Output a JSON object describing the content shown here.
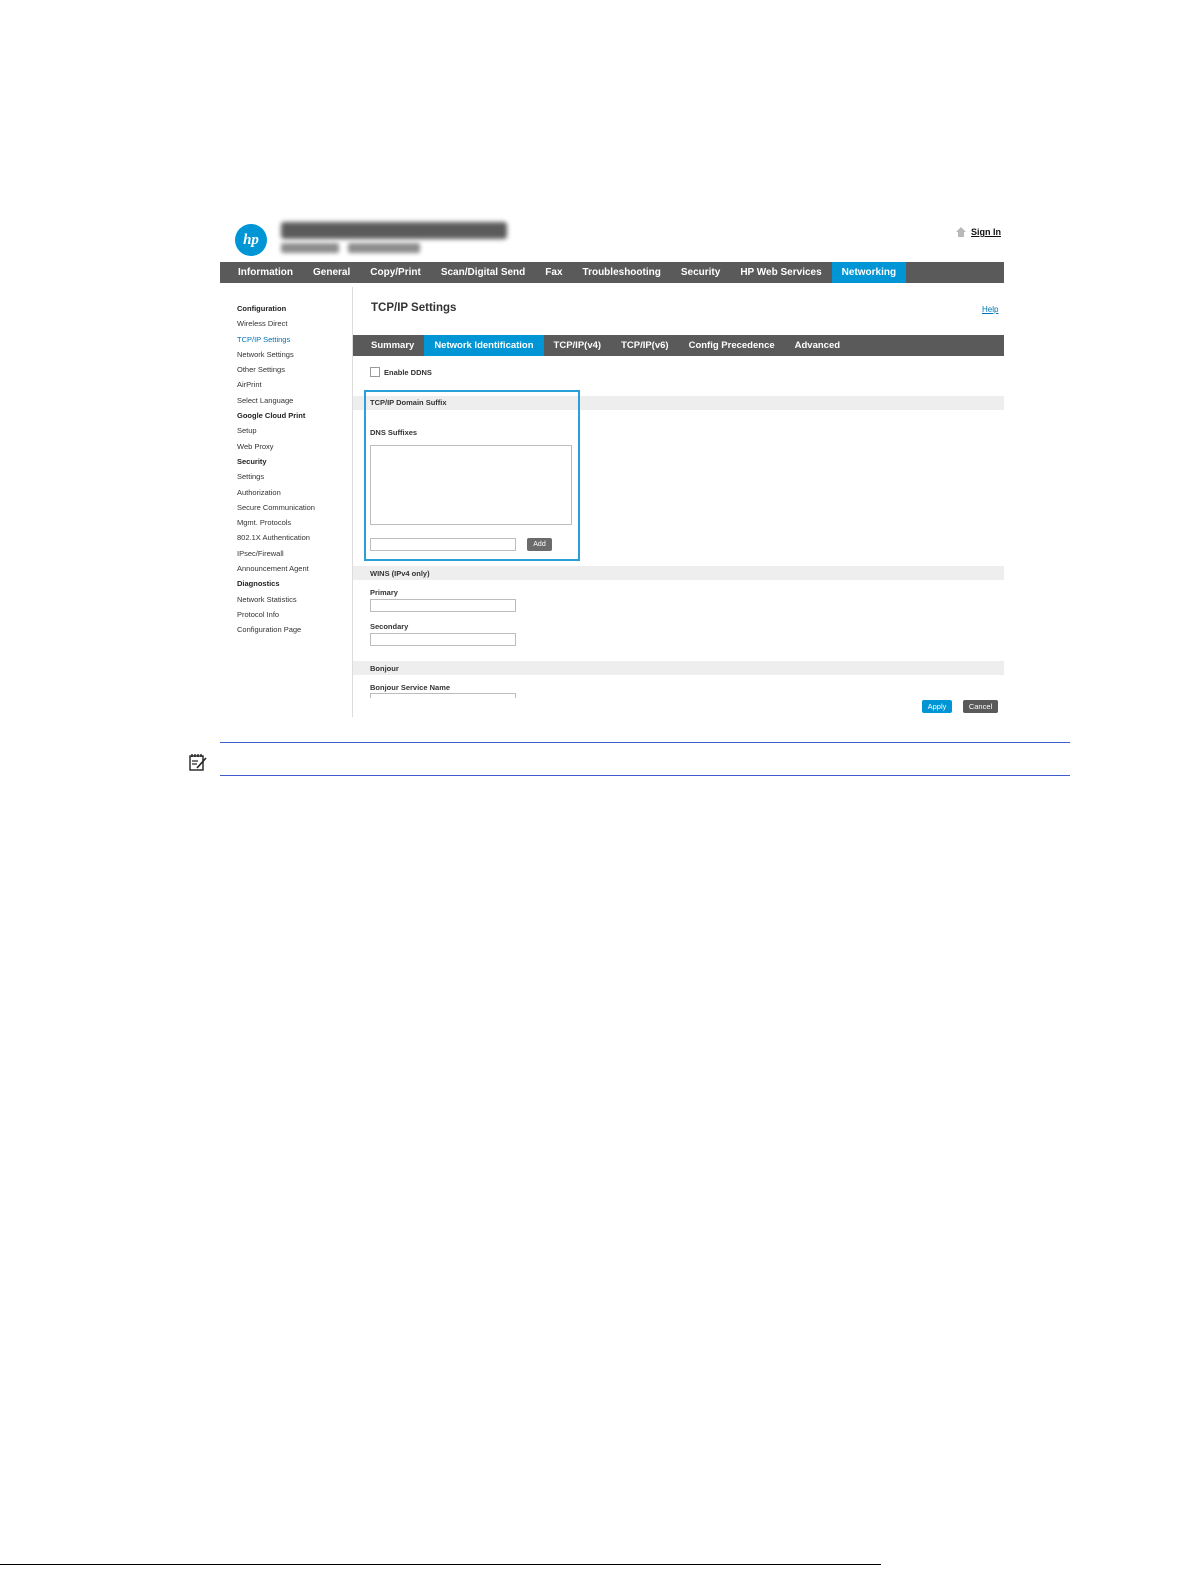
{
  "header": {
    "signin_label": "Sign In"
  },
  "topnav": [
    "Information",
    "General",
    "Copy/Print",
    "Scan/Digital Send",
    "Fax",
    "Troubleshooting",
    "Security",
    "HP Web Services",
    "Networking"
  ],
  "topnav_active": "Networking",
  "leftnav": [
    {
      "label": "Configuration",
      "bold": true
    },
    {
      "label": "Wireless Direct"
    },
    {
      "label": "TCP/IP Settings",
      "selected": true
    },
    {
      "label": "Network Settings"
    },
    {
      "label": "Other Settings"
    },
    {
      "label": "AirPrint"
    },
    {
      "label": "Select Language"
    },
    {
      "label": "Google Cloud Print",
      "bold": true
    },
    {
      "label": "Setup"
    },
    {
      "label": "Web Proxy"
    },
    {
      "label": "Security",
      "bold": true
    },
    {
      "label": "Settings"
    },
    {
      "label": "Authorization"
    },
    {
      "label": "Secure Communication"
    },
    {
      "label": "Mgmt. Protocols"
    },
    {
      "label": "802.1X Authentication"
    },
    {
      "label": "IPsec/Firewall"
    },
    {
      "label": "Announcement Agent"
    },
    {
      "label": "Diagnostics",
      "bold": true
    },
    {
      "label": "Network Statistics"
    },
    {
      "label": "Protocol Info"
    },
    {
      "label": "Configuration Page"
    }
  ],
  "main": {
    "title": "TCP/IP Settings",
    "help": "Help",
    "subtabs": [
      "Summary",
      "Network Identification",
      "TCP/IP(v4)",
      "TCP/IP(v6)",
      "Config Precedence",
      "Advanced"
    ],
    "subtab_active": "Network Identification",
    "enable_ddns_label": "Enable DDNS",
    "enable_ddns_checked": false,
    "domain_suffix_section": "TCP/IP Domain Suffix",
    "dns_suffixes_label": "DNS Suffixes",
    "add_button": "Add",
    "wins_section": "WINS (IPv4 only)",
    "primary_label": "Primary",
    "secondary_label": "Secondary",
    "bonjour_section": "Bonjour",
    "bonjour_service_name_label": "Bonjour Service Name",
    "apply_button": "Apply",
    "cancel_button": "Cancel"
  },
  "colors": {
    "nav_bg": "#5a5a5a",
    "accent": "#0096d6",
    "highlight_border": "#2aa0d8",
    "note_rule": "#3f5bd0"
  },
  "icons": {
    "logo": "hp-logo",
    "home": "home-icon",
    "note": "note-icon"
  }
}
